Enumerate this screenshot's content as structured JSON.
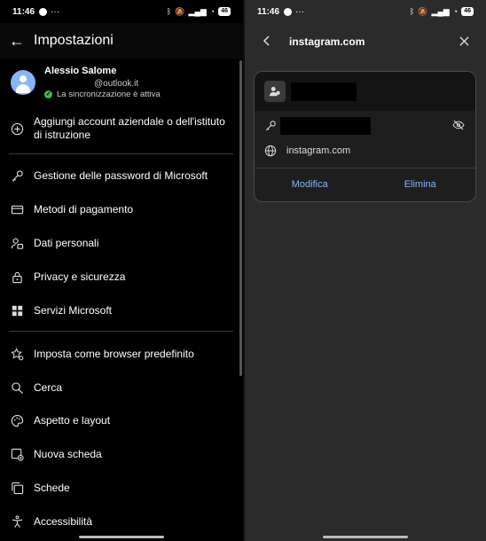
{
  "left": {
    "status": {
      "time": "11:46",
      "battery": "46"
    },
    "header": {
      "title": "Impostazioni"
    },
    "profile": {
      "name": "Alessio Salome",
      "email": "@outlook.it",
      "sync": "La sincronizzazione è attiva"
    },
    "items": [
      {
        "label": "Aggiungi account aziendale o dell'istituto di istruzione",
        "icon": "add-circle-icon"
      },
      {
        "label": "Gestione delle password di Microsoft",
        "icon": "key-icon"
      },
      {
        "label": "Metodi di pagamento",
        "icon": "credit-card-icon"
      },
      {
        "label": "Dati personali",
        "icon": "person-details-icon"
      },
      {
        "label": "Privacy e sicurezza",
        "icon": "lock-icon"
      },
      {
        "label": "Servizi Microsoft",
        "icon": "grid-icon"
      },
      {
        "label": "Imposta come browser predefinito",
        "icon": "star-settings-icon"
      },
      {
        "label": "Cerca",
        "icon": "search-icon"
      },
      {
        "label": "Aspetto e layout",
        "icon": "palette-icon"
      },
      {
        "label": "Nuova scheda",
        "icon": "new-tab-icon"
      },
      {
        "label": "Schede",
        "icon": "tabs-icon"
      },
      {
        "label": "Accessibilità",
        "icon": "accessibility-icon"
      }
    ]
  },
  "right": {
    "status": {
      "time": "11:46",
      "battery": "46"
    },
    "header": {
      "title": "instagram.com"
    },
    "card": {
      "site": "instagram.com",
      "edit_label": "Modifica",
      "delete_label": "Elimina"
    }
  },
  "colors": {
    "accent": "#8ab4f8",
    "sync_ok": "#3fb950"
  }
}
